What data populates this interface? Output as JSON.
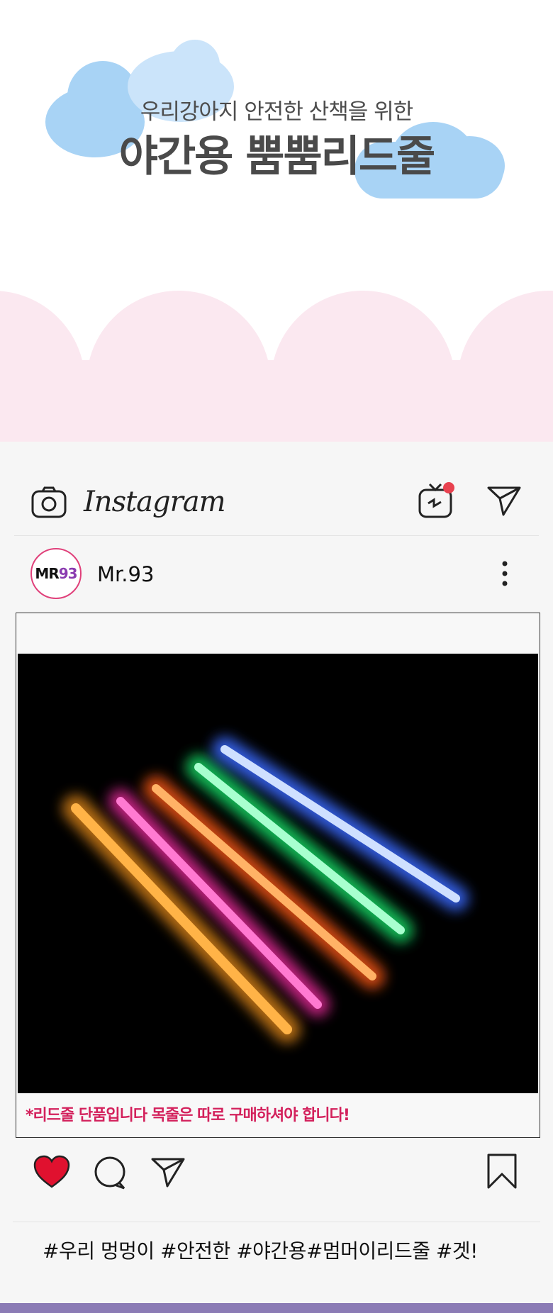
{
  "hero": {
    "subtitle": "우리강아지 안전한 산책을 위한",
    "title": "야간용 뿜뿜리드줄"
  },
  "topbar": {
    "logo": "Instagram",
    "icons": [
      "camera-icon",
      "igtv-icon",
      "send-icon"
    ],
    "notification_dot_color": "#e8414f"
  },
  "profile": {
    "avatar_mr": "MR",
    "avatar_93": "93",
    "username": "Mr.93",
    "menu_icon": "more-vertical-icon"
  },
  "post": {
    "image_alt": "LED light-up leash product photo",
    "leash_colors": [
      "#ff9a1a",
      "#ff2fa8",
      "#ff5a14",
      "#16e36a",
      "#3a6bff"
    ],
    "notice": "*리드줄 단품입니다 목줄은 따로 구매하셔야 합니다!"
  },
  "actions": {
    "liked": true,
    "like_color": "#e0112f",
    "icons": [
      "heart-icon",
      "comment-icon",
      "send-icon",
      "bookmark-icon"
    ]
  },
  "caption": "#우리 멍멍이 #안전한 #야간용#멈머이리드줄 #겟!"
}
